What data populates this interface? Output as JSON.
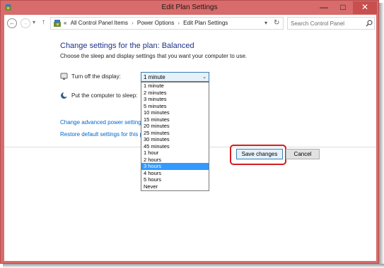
{
  "window": {
    "title": "Edit Plan Settings",
    "controls": {
      "minimize": "—",
      "maximize": "□",
      "close": "✕"
    }
  },
  "nav": {
    "breadcrumbs": [
      "All Control Panel Items",
      "Power Options",
      "Edit Plan Settings"
    ],
    "lead": "«",
    "search_placeholder": "Search Control Panel"
  },
  "page": {
    "heading": "Change settings for the plan: Balanced",
    "subheading": "Choose the sleep and display settings that you want your computer to use."
  },
  "settings": {
    "display": {
      "label": "Turn off the display:",
      "selected": "1 minute",
      "options": [
        "1 minute",
        "2 minutes",
        "3 minutes",
        "5 minutes",
        "10 minutes",
        "15 minutes",
        "20 minutes",
        "25 minutes",
        "30 minutes",
        "45 minutes",
        "1 hour",
        "2 hours",
        "3 hours",
        "4 hours",
        "5 hours",
        "Never"
      ],
      "highlighted_option": "3 hours"
    },
    "sleep": {
      "label": "Put the computer to sleep:"
    }
  },
  "links": {
    "advanced": "Change advanced power settings",
    "restore": "Restore default settings for this pla"
  },
  "buttons": {
    "save": "Save changes",
    "cancel": "Cancel"
  },
  "colors": {
    "title_bar": "#d86b6b",
    "heading": "#1e3287",
    "link": "#0066cc",
    "selection": "#3399ff",
    "annotation": "#d21f1f"
  }
}
